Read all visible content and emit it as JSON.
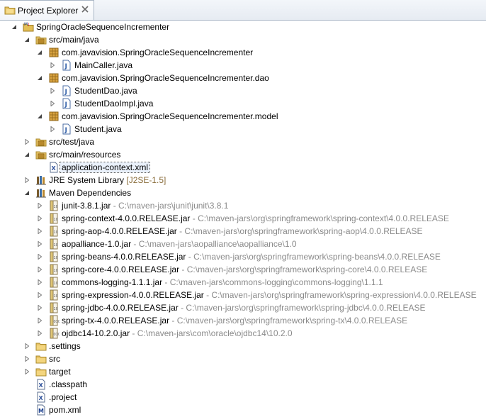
{
  "tab": {
    "label": "Project Explorer"
  },
  "tree": [
    {
      "level": 1,
      "tw": "open",
      "icon": "project-icon",
      "label": "SpringOracleSequenceIncrementer",
      "dec": ""
    },
    {
      "level": 2,
      "tw": "open",
      "icon": "source-folder-icon",
      "label": "src/main/java",
      "dec": ""
    },
    {
      "level": 3,
      "tw": "open",
      "icon": "package-icon",
      "label": "com.javavision.SpringOracleSequenceIncrementer",
      "dec": ""
    },
    {
      "level": 4,
      "tw": "closed",
      "icon": "java-file-icon",
      "label": "MainCaller.java",
      "dec": ""
    },
    {
      "level": 3,
      "tw": "open",
      "icon": "package-icon",
      "label": "com.javavision.SpringOracleSequenceIncrementer.dao",
      "dec": ""
    },
    {
      "level": 4,
      "tw": "closed",
      "icon": "java-file-icon",
      "label": "StudentDao.java",
      "dec": ""
    },
    {
      "level": 4,
      "tw": "closed",
      "icon": "java-file-icon",
      "label": "StudentDaoImpl.java",
      "dec": ""
    },
    {
      "level": 3,
      "tw": "open",
      "icon": "package-icon",
      "label": "com.javavision.SpringOracleSequenceIncrementer.model",
      "dec": ""
    },
    {
      "level": 4,
      "tw": "closed",
      "icon": "java-file-icon",
      "label": "Student.java",
      "dec": ""
    },
    {
      "level": 2,
      "tw": "closed",
      "icon": "source-folder-icon",
      "label": "src/test/java",
      "dec": ""
    },
    {
      "level": 2,
      "tw": "open",
      "icon": "source-folder-icon",
      "label": "src/main/resources",
      "dec": ""
    },
    {
      "level": 3,
      "tw": "none",
      "icon": "xml-file-icon",
      "label": "application-context.xml",
      "dec": "",
      "selected": true
    },
    {
      "level": 2,
      "tw": "closed",
      "icon": "library-icon",
      "label": "JRE System Library",
      "dec": "[J2SE-1.5]"
    },
    {
      "level": 2,
      "tw": "open",
      "icon": "library-icon",
      "label": "Maven Dependencies",
      "dec": ""
    },
    {
      "level": 3,
      "tw": "closed",
      "icon": "jar-icon",
      "label": "junit-3.8.1.jar",
      "dec": "- C:\\maven-jars\\junit\\junit\\3.8.1"
    },
    {
      "level": 3,
      "tw": "closed",
      "icon": "jar-icon",
      "label": "spring-context-4.0.0.RELEASE.jar",
      "dec": "- C:\\maven-jars\\org\\springframework\\spring-context\\4.0.0.RELEASE"
    },
    {
      "level": 3,
      "tw": "closed",
      "icon": "jar-icon",
      "label": "spring-aop-4.0.0.RELEASE.jar",
      "dec": "- C:\\maven-jars\\org\\springframework\\spring-aop\\4.0.0.RELEASE"
    },
    {
      "level": 3,
      "tw": "closed",
      "icon": "jar-icon",
      "label": "aopalliance-1.0.jar",
      "dec": "- C:\\maven-jars\\aopalliance\\aopalliance\\1.0"
    },
    {
      "level": 3,
      "tw": "closed",
      "icon": "jar-icon",
      "label": "spring-beans-4.0.0.RELEASE.jar",
      "dec": "- C:\\maven-jars\\org\\springframework\\spring-beans\\4.0.0.RELEASE"
    },
    {
      "level": 3,
      "tw": "closed",
      "icon": "jar-icon",
      "label": "spring-core-4.0.0.RELEASE.jar",
      "dec": "- C:\\maven-jars\\org\\springframework\\spring-core\\4.0.0.RELEASE"
    },
    {
      "level": 3,
      "tw": "closed",
      "icon": "jar-icon",
      "label": "commons-logging-1.1.1.jar",
      "dec": "- C:\\maven-jars\\commons-logging\\commons-logging\\1.1.1"
    },
    {
      "level": 3,
      "tw": "closed",
      "icon": "jar-icon",
      "label": "spring-expression-4.0.0.RELEASE.jar",
      "dec": "- C:\\maven-jars\\org\\springframework\\spring-expression\\4.0.0.RELEASE"
    },
    {
      "level": 3,
      "tw": "closed",
      "icon": "jar-icon",
      "label": "spring-jdbc-4.0.0.RELEASE.jar",
      "dec": "- C:\\maven-jars\\org\\springframework\\spring-jdbc\\4.0.0.RELEASE"
    },
    {
      "level": 3,
      "tw": "closed",
      "icon": "binary-jar-icon",
      "label": "spring-tx-4.0.0.RELEASE.jar",
      "dec": "- C:\\maven-jars\\org\\springframework\\spring-tx\\4.0.0.RELEASE"
    },
    {
      "level": 3,
      "tw": "closed",
      "icon": "binary-jar-icon",
      "label": "ojdbc14-10.2.0.jar",
      "dec": "- C:\\maven-jars\\com\\oracle\\ojdbc14\\10.2.0"
    },
    {
      "level": 2,
      "tw": "closed",
      "icon": "folder-icon",
      "label": ".settings",
      "dec": ""
    },
    {
      "level": 2,
      "tw": "closed",
      "icon": "folder-icon",
      "label": "src",
      "dec": ""
    },
    {
      "level": 2,
      "tw": "closed",
      "icon": "folder-icon",
      "label": "target",
      "dec": ""
    },
    {
      "level": 2,
      "tw": "none",
      "icon": "xml-file-icon",
      "label": ".classpath",
      "dec": ""
    },
    {
      "level": 2,
      "tw": "none",
      "icon": "xml-file-icon",
      "label": ".project",
      "dec": ""
    },
    {
      "level": 2,
      "tw": "none",
      "icon": "maven-pom-icon",
      "label": "pom.xml",
      "dec": ""
    }
  ]
}
